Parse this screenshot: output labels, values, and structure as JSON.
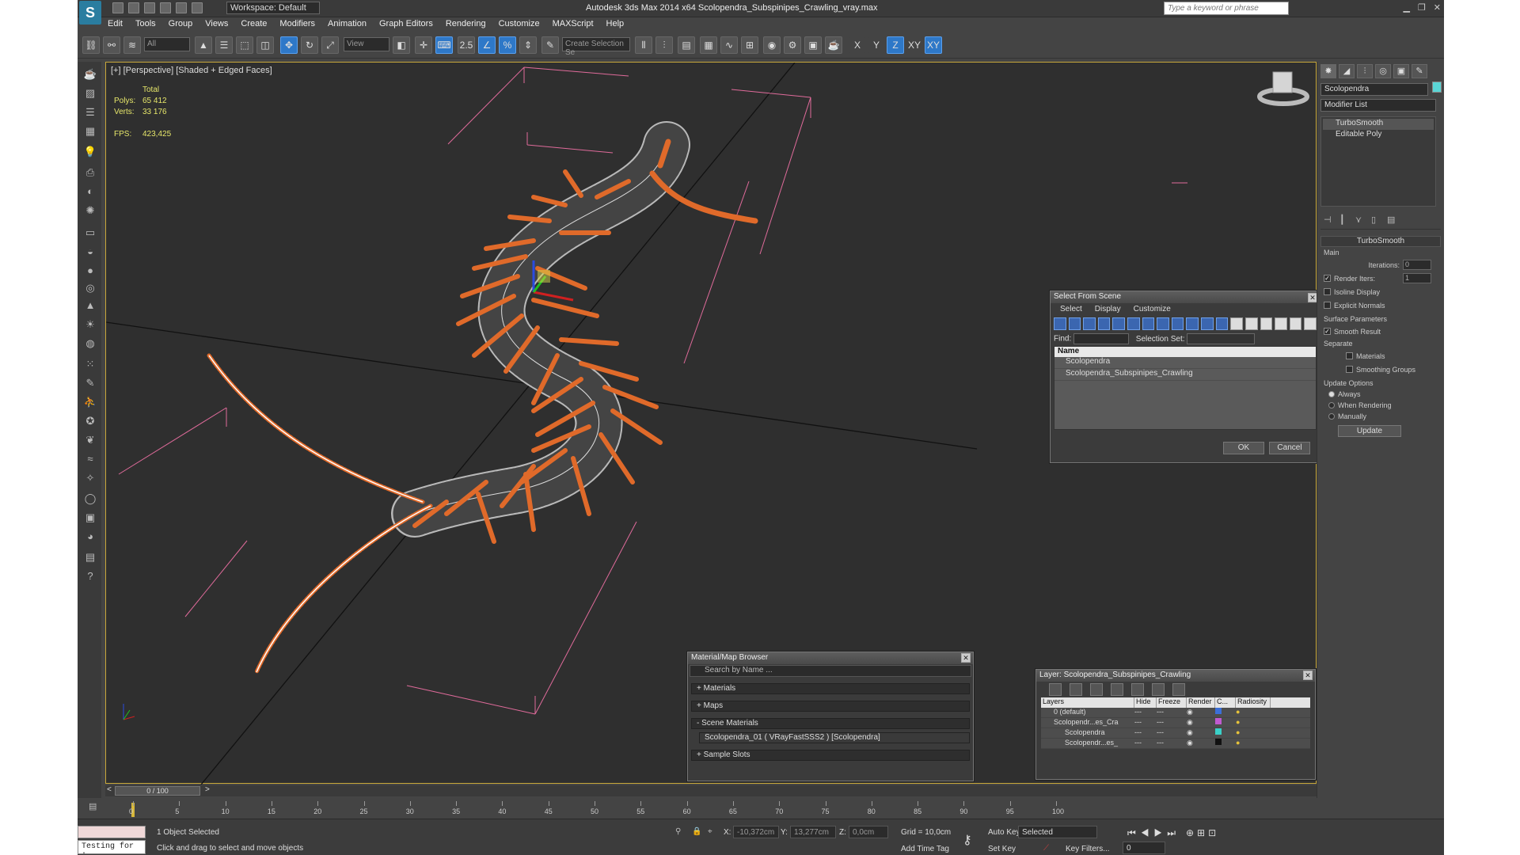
{
  "app": {
    "title": "Autodesk 3ds Max  2014 x64     Scolopendra_Subspinipes_Crawling_vray.max",
    "logo_letter": "S",
    "workspace": "Workspace: Default",
    "search_placeholder": "Type a keyword or phrase",
    "menu": [
      "Edit",
      "Tools",
      "Group",
      "Views",
      "Create",
      "Modifiers",
      "Animation",
      "Graph Editors",
      "Rendering",
      "Customize",
      "MAXScript",
      "Help"
    ]
  },
  "toolbar": {
    "filter": "All",
    "refcoord": "View",
    "snap_angle": "2.5",
    "named_selection": "Create Selection Se",
    "axis_x": "X",
    "axis_y": "Y",
    "axis_z": "Z",
    "axis_xy": "XY",
    "axis_xy2": "XY"
  },
  "viewport": {
    "label": "[+] [Perspective] [Shaded + Edged Faces]",
    "stats": {
      "total_label": "Total",
      "polys_label": "Polys:",
      "polys_value": "65 412",
      "verts_label": "Verts:",
      "verts_value": "33 176",
      "fps_label": "FPS:",
      "fps_value": "423,425"
    }
  },
  "command_panel": {
    "object_name": "Scolopendra",
    "object_color": "#5ad5d5",
    "modifier_list": "Modifier List",
    "stack": [
      "TurboSmooth",
      "Editable Poly"
    ],
    "rollout_title": "TurboSmooth",
    "main_label": "Main",
    "iterations_label": "Iterations:",
    "iterations_value": "0",
    "render_iters_label": "Render Iters:",
    "render_iters_value": "1",
    "isoline_label": "Isoline Display",
    "explicit_label": "Explicit Normals",
    "surface_label": "Surface Parameters",
    "smooth_label": "Smooth Result",
    "separate_label": "Separate",
    "materials_label": "Materials",
    "smoothing_label": "Smoothing Groups",
    "update_options_label": "Update Options",
    "always_label": "Always",
    "when_rendering_label": "When Rendering",
    "manually_label": "Manually",
    "update_button": "Update"
  },
  "select_dialog": {
    "title": "Select From Scene",
    "menu": [
      "Select",
      "Display",
      "Customize"
    ],
    "find_label": "Find:",
    "selection_set_label": "Selection Set:",
    "column_name": "Name",
    "items": [
      "Scolopendra",
      "Scolopendra_Subspinipes_Crawling"
    ],
    "ok": "OK",
    "cancel": "Cancel"
  },
  "material_browser": {
    "title": "Material/Map Browser",
    "search": "Search by Name ...",
    "groups": [
      "+ Materials",
      "+ Maps",
      "- Scene Materials"
    ],
    "material": "Scolopendra_01  ( VRayFastSSS2 )  [Scolopendra]",
    "sample_slots": "+ Sample Slots"
  },
  "layer_dialog": {
    "title": "Layer: Scolopendra_Subspinipes_Crawling",
    "columns": [
      "Layers",
      "Hide",
      "Freeze",
      "Render",
      "C...",
      "Radiosity"
    ],
    "rows": [
      "0 (default)",
      "Scolopendr...es_Cra",
      "Scolopendra",
      "Scolopendr...es_"
    ]
  },
  "timeline": {
    "slider": "0 / 100",
    "ticks": [
      "0",
      "5",
      "10",
      "15",
      "20",
      "25",
      "30",
      "35",
      "40",
      "45",
      "50",
      "55",
      "60",
      "65",
      "70",
      "75",
      "80",
      "85",
      "90",
      "95",
      "100"
    ]
  },
  "status": {
    "selected": "1 Object Selected",
    "prompt": "Click and drag to select and move objects",
    "maxscript": "Testing for :",
    "x_label": "X:",
    "x_value": "-10,372cm",
    "y_label": "Y:",
    "y_value": "13,277cm",
    "z_label": "Z:",
    "z_value": "0,0cm",
    "grid": "Grid = 10,0cm",
    "add_time_tag": "Add Time Tag",
    "auto_key": "Auto Key",
    "selected_dropdown": "Selected",
    "set_key": "Set Key",
    "key_filters": "Key Filters...",
    "frame": "0"
  }
}
